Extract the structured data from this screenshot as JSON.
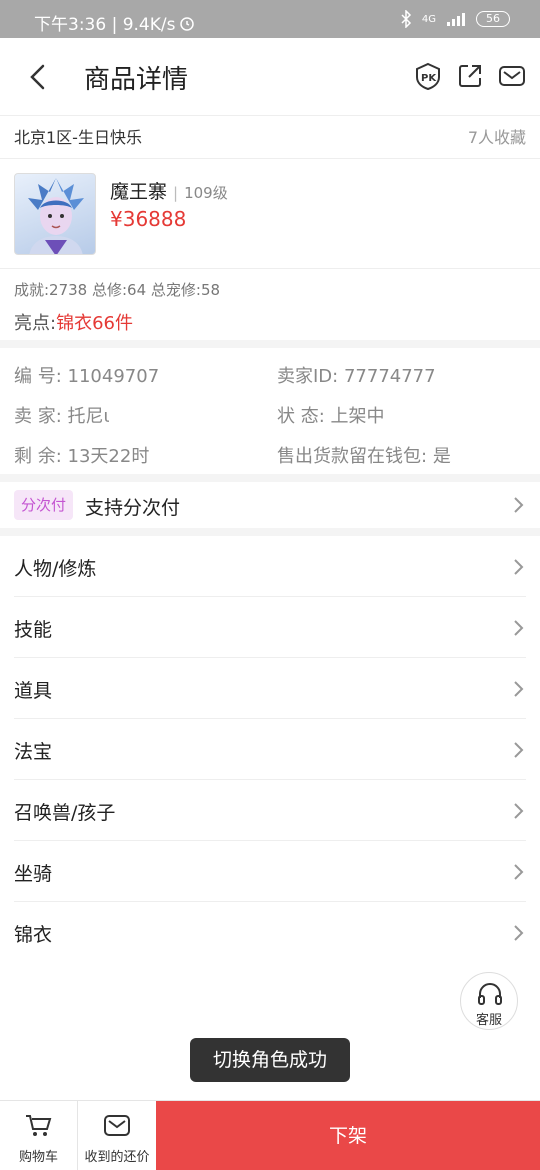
{
  "status_bar": {
    "time_speed": "下午3:36 | 9.4K/s",
    "network": "4G",
    "battery": "56"
  },
  "nav": {
    "title": "商品详情"
  },
  "server": {
    "name": "北京1区-生日快乐",
    "favorites": "7人收藏"
  },
  "role": {
    "name": "魔王寨",
    "separator": "|",
    "level": "109级",
    "price": "¥36888"
  },
  "stats": {
    "line": "成就:2738 总修:64 总宠修:58",
    "highlight_label": "亮点:",
    "highlight_value": "锦衣66件"
  },
  "info": {
    "id_label": "编  号:",
    "id_value": "11049707",
    "seller_id_label": "卖家ID:",
    "seller_id_value": "77774777",
    "seller_label": "卖  家:",
    "seller_value": "托尼ι",
    "status_label": "状  态:",
    "status_value": "上架中",
    "remaining_label": "剩  余:",
    "remaining_value": "13天22时",
    "wallet_label": "售出货款留在钱包:",
    "wallet_value": "是"
  },
  "installment": {
    "tag": "分次付",
    "label": "支持分次付"
  },
  "menu": [
    {
      "label": "人物/修炼"
    },
    {
      "label": "技能"
    },
    {
      "label": "道具"
    },
    {
      "label": "法宝"
    },
    {
      "label": "召唤兽/孩子"
    },
    {
      "label": "坐骑"
    },
    {
      "label": "锦衣"
    }
  ],
  "customer_service": {
    "label": "客服"
  },
  "toast": {
    "message": "切换角色成功"
  },
  "bottom_bar": {
    "cart_label": "购物车",
    "offer_label": "收到的还价",
    "delist_label": "下架"
  },
  "colors": {
    "accent_red": "#e53935",
    "delist_button": "#ea4848",
    "tag_bg": "#f6e6f8",
    "tag_text": "#c455d1"
  }
}
